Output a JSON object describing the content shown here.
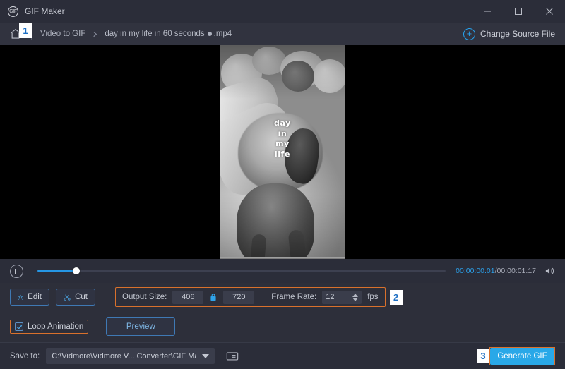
{
  "window": {
    "title": "GIF Maker",
    "logo_icon": "gif-app-logo-icon",
    "minimize_icon": "minimize-icon",
    "maximize_icon": "maximize-icon",
    "close_icon": "close-icon"
  },
  "breadcrumb": {
    "home_icon": "home-icon",
    "chevron_icon": "chevron-right-icon",
    "section": "Video to GIF",
    "file_name": "day in my life in 60 seconds",
    "file_ext": ".mp4",
    "change_source_label": "Change Source File",
    "change_source_icon": "plus-circle-icon"
  },
  "preview": {
    "caption_lines": [
      "day",
      "in",
      "my",
      "life"
    ]
  },
  "playback": {
    "pause_icon": "pause-icon",
    "current_time": "00:00:00.01",
    "total_time": "/00:00:01.17",
    "volume_icon": "volume-icon",
    "progress_percent": 9.5
  },
  "toolbar": {
    "edit_label": "Edit",
    "edit_icon": "magic-wand-icon",
    "cut_label": "Cut",
    "cut_icon": "scissors-icon",
    "output_size_label": "Output Size:",
    "output_width": "406",
    "output_height": "720",
    "lock_icon": "lock-icon",
    "frame_rate_label": "Frame Rate:",
    "frame_rate": "12",
    "frame_rate_unit": "fps",
    "spinner_up_icon": "chevron-up-icon",
    "spinner_down_icon": "chevron-down-icon",
    "badge_2": "2"
  },
  "options": {
    "loop_label": "Loop Animation",
    "loop_checked": true,
    "check_icon": "checkmark-icon",
    "preview_label": "Preview",
    "badge_1": "1"
  },
  "footer": {
    "save_to_label": "Save to:",
    "save_path": "C:\\Vidmore\\Vidmore V... Converter\\GIF Maker",
    "dropdown_icon": "caret-down-icon",
    "folder_icon": "folder-open-icon",
    "generate_label": "Generate GIF",
    "badge_3": "3"
  },
  "colors": {
    "accent_blue": "#29a8e8",
    "highlight_orange": "#d9712c",
    "panel_bg": "#2d2f3a",
    "titlebar_bg": "#2b2d39",
    "crumbbar_bg": "#31333f"
  }
}
